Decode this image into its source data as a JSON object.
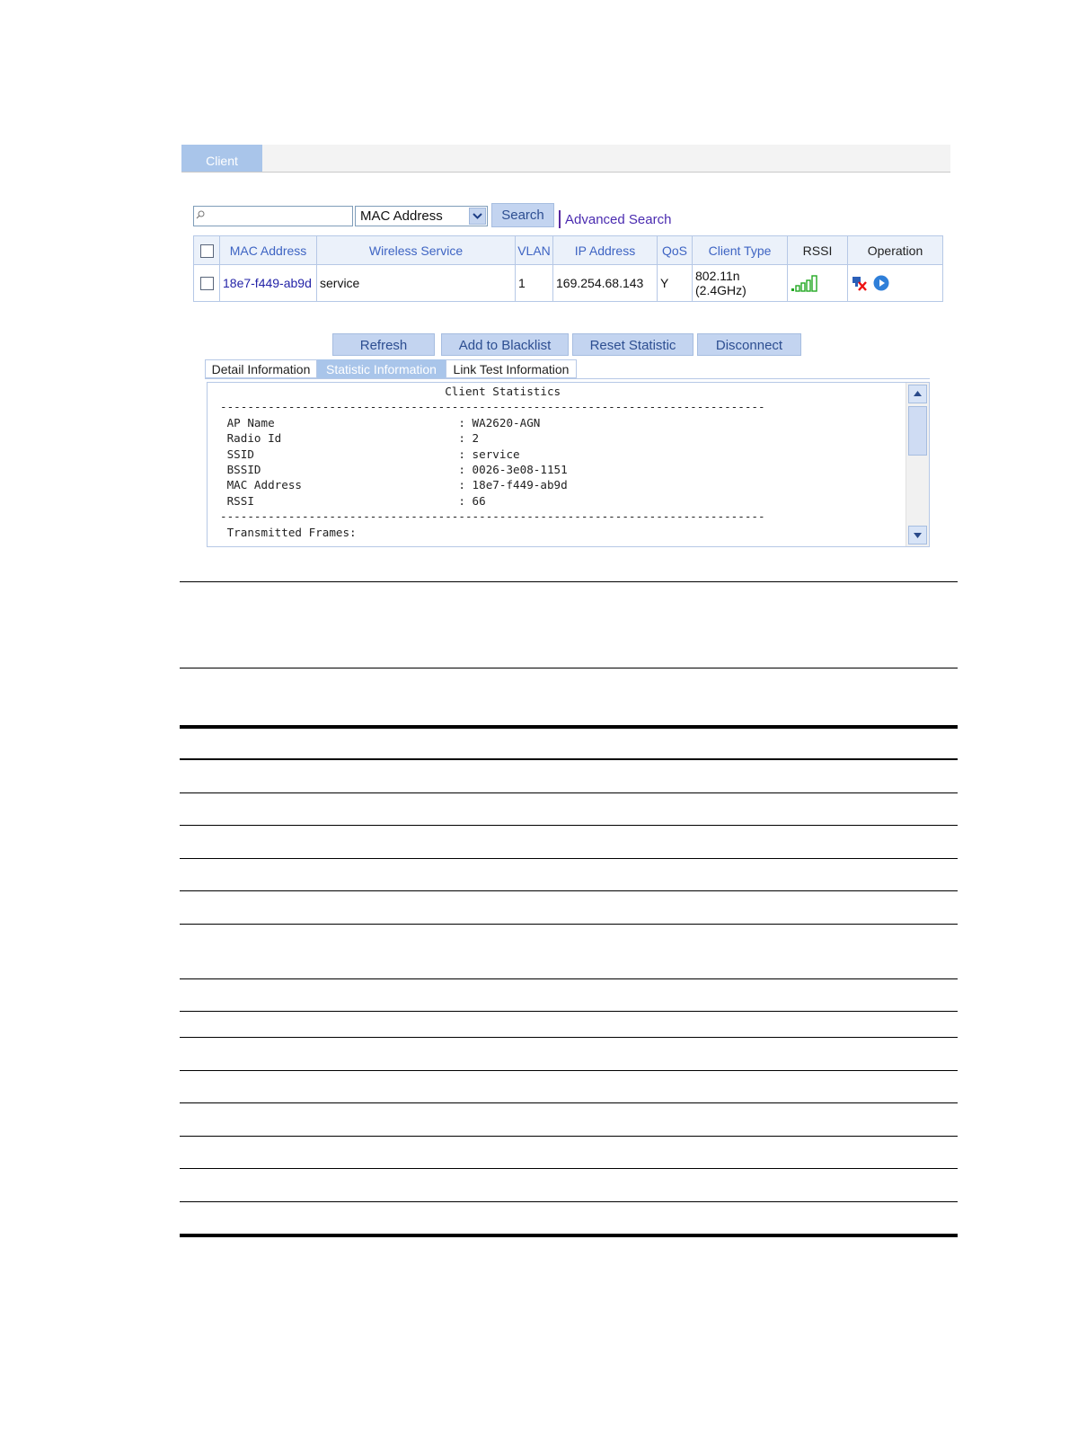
{
  "tabs": {
    "client": "Client"
  },
  "search": {
    "placeholder": "",
    "filter_value": "MAC Address",
    "search_label": "Search",
    "advanced_label": "Advanced Search"
  },
  "table": {
    "headers": {
      "mac": "MAC Address",
      "service": "Wireless Service",
      "vlan": "VLAN",
      "ip": "IP Address",
      "qos": "QoS",
      "type": "Client Type",
      "rssi": "RSSI",
      "operation": "Operation"
    },
    "row": {
      "mac": "18e7-f449-ab9d",
      "service": "service",
      "vlan": "1",
      "ip": "169.254.68.143",
      "qos": "Y",
      "type_line1": "802.11n",
      "type_line2": "(2.4GHz)",
      "rssi_bars_lit": 5
    }
  },
  "actions": {
    "refresh": "Refresh",
    "blacklist": "Add to Blacklist",
    "reset": "Reset Statistic",
    "disconnect": "Disconnect"
  },
  "detail_tabs": {
    "detail": "Detail Information",
    "statistic": "Statistic Information",
    "linktest": "Link Test Information"
  },
  "stats": {
    "title": "Client Statistics",
    "rows": [
      {
        "label": "AP Name",
        "value": "WA2620-AGN"
      },
      {
        "label": "Radio Id",
        "value": "2"
      },
      {
        "label": "SSID",
        "value": "service"
      },
      {
        "label": "BSSID",
        "value": "0026-3e08-1151"
      },
      {
        "label": "MAC Address",
        "value": "18e7-f449-ab9d"
      },
      {
        "label": "RSSI",
        "value": "66"
      }
    ],
    "section": "Transmitted Frames:"
  },
  "colors": {
    "accent": "#a9c5ea",
    "button": "#c3d4f0",
    "header_text": "#3e64c3",
    "link": "#2424a8",
    "rssi_green": "#22a822"
  }
}
